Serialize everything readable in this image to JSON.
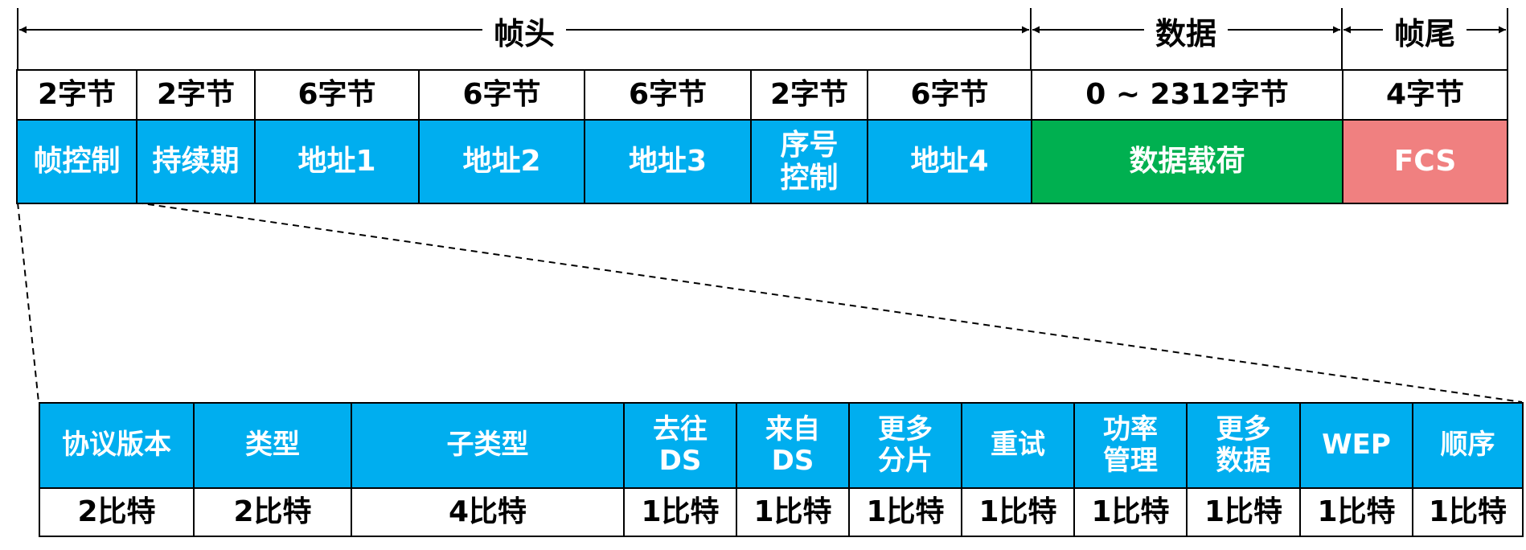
{
  "sections": [
    {
      "label": "帧头"
    },
    {
      "label": "数据"
    },
    {
      "label": "帧尾"
    }
  ],
  "top_row": [
    {
      "size": "2字节",
      "field": "帧控制"
    },
    {
      "size": "2字节",
      "field": "持续期"
    },
    {
      "size": "6字节",
      "field": "地址1"
    },
    {
      "size": "6字节",
      "field": "地址2"
    },
    {
      "size": "6字节",
      "field": "地址3"
    },
    {
      "size": "2字节",
      "field": "序号\n控制"
    },
    {
      "size": "6字节",
      "field": "地址4"
    },
    {
      "size": "0 ~ 2312字节",
      "field": "数据载荷"
    },
    {
      "size": "4字节",
      "field": "FCS"
    }
  ],
  "bottom_row": [
    {
      "field": "协议版本",
      "size": "2比特"
    },
    {
      "field": "类型",
      "size": "2比特"
    },
    {
      "field": "子类型",
      "size": "4比特"
    },
    {
      "field": "去往\nDS",
      "size": "1比特"
    },
    {
      "field": "来自\nDS",
      "size": "1比特"
    },
    {
      "field": "更多\n分片",
      "size": "1比特"
    },
    {
      "field": "重试",
      "size": "1比特"
    },
    {
      "field": "功率\n管理",
      "size": "1比特"
    },
    {
      "field": "更多\n数据",
      "size": "1比特"
    },
    {
      "field": "WEP",
      "size": "1比特"
    },
    {
      "field": "顺序",
      "size": "1比特"
    }
  ],
  "colors": {
    "header_fields": "#00aeef",
    "data_payload": "#00b050",
    "fcs": "#f08080"
  }
}
